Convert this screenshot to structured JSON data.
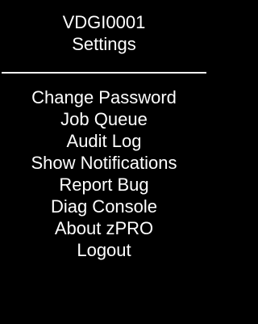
{
  "header": {
    "device_id": "VDGI0001",
    "title": "Settings"
  },
  "menu": {
    "items": [
      {
        "label": "Change Password"
      },
      {
        "label": "Job Queue"
      },
      {
        "label": "Audit Log"
      },
      {
        "label": "Show Notifications"
      },
      {
        "label": "Report Bug"
      },
      {
        "label": "Diag Console"
      },
      {
        "label": "About zPRO"
      },
      {
        "label": "Logout"
      }
    ]
  },
  "colors": {
    "background": "#000000",
    "text": "#ffffff"
  }
}
